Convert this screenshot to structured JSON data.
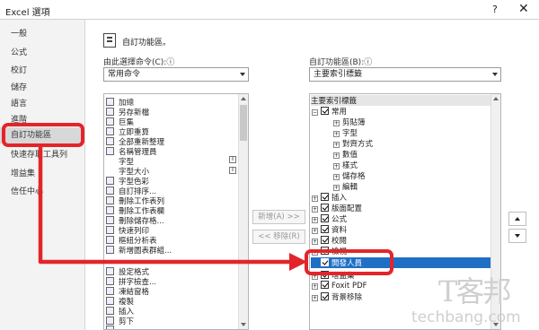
{
  "window": {
    "title": "Excel 選項",
    "help": "?",
    "close": "✕"
  },
  "sidebar": {
    "items": [
      {
        "label": "一般"
      },
      {
        "label": "公式"
      },
      {
        "label": "校訂"
      },
      {
        "label": "儲存"
      },
      {
        "label": "語言"
      },
      {
        "label": "進階"
      },
      {
        "label": "自訂功能區"
      },
      {
        "label": "快速存取工具列"
      },
      {
        "label": "增益集"
      },
      {
        "label": "信任中心"
      }
    ]
  },
  "main": {
    "title": "自訂功能區。",
    "choose_label": "由此選擇命令(C):ⓘ",
    "choose_value": "常用命令",
    "ribbon_label": "自訂功能區(B):ⓘ",
    "ribbon_value": "主要索引標籤"
  },
  "commands": [
    "加總",
    "另存新檔",
    "巨集",
    "立即重算",
    "全部重新整理",
    "名稱管理員",
    "字型",
    "字型大小",
    "字型色彩",
    "自訂排序...",
    "刪除工作表列",
    "刪除工作表欄",
    "刪除儲存格...",
    "快速列印",
    "樞紐分析表",
    "新增圖表群組...",
    "",
    "設定格式",
    "拼字檢查...",
    "凍結窗格",
    "複製",
    "插入",
    "剪下"
  ],
  "buttons": {
    "add": "新增(A) >>",
    "remove": "<< 移除(R)"
  },
  "tree": {
    "header": "主要索引標籤",
    "rows": [
      {
        "label": "常用"
      },
      {
        "label": "剪貼簿"
      },
      {
        "label": "字型"
      },
      {
        "label": "對齊方式"
      },
      {
        "label": "數值"
      },
      {
        "label": "樣式"
      },
      {
        "label": "儲存格"
      },
      {
        "label": "編輯"
      },
      {
        "label": "插入"
      },
      {
        "label": "版面配置"
      },
      {
        "label": "公式"
      },
      {
        "label": "資料"
      },
      {
        "label": "校閱"
      },
      {
        "label": "檢視"
      },
      {
        "label": "開發人員"
      },
      {
        "label": "增益集"
      },
      {
        "label": "Foxit PDF"
      },
      {
        "label": "背景移除"
      }
    ]
  },
  "watermark": {
    "brand": "T客邦",
    "url": "techbang.com"
  },
  "colors": {
    "highlight": "#e3252a",
    "selection": "#1f6fc5"
  }
}
